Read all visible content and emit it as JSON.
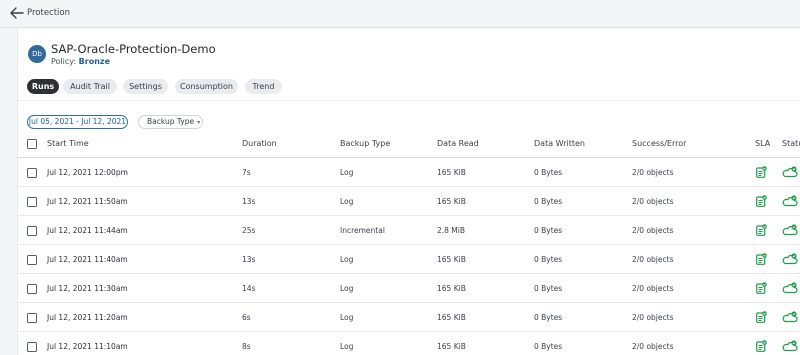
{
  "breadcrumb": {
    "label": "Protection"
  },
  "header": {
    "avatar_initials": "Db",
    "title": "SAP-Oracle-Protection-Demo",
    "policy_label": "Policy:",
    "policy_value": "Bronze"
  },
  "tabs": [
    {
      "label": "Runs",
      "active": true
    },
    {
      "label": "Audit Trail",
      "active": false
    },
    {
      "label": "Settings",
      "active": false
    },
    {
      "label": "Consumption",
      "active": false
    },
    {
      "label": "Trend",
      "active": false
    }
  ],
  "filters": {
    "date_range": "Jul 05, 2021 - Jul 12, 2021",
    "backup_type": "Backup Type"
  },
  "table": {
    "columns": [
      "Start Time",
      "Duration",
      "Backup Type",
      "Data Read",
      "Data Written",
      "Success/Error",
      "SLA",
      "Status"
    ],
    "rows": [
      {
        "start": "Jul 12, 2021 12:00pm",
        "duration": "7s",
        "type": "Log",
        "read": "165 KiB",
        "written": "0 Bytes",
        "result": "2/0 objects"
      },
      {
        "start": "Jul 12, 2021 11:50am",
        "duration": "13s",
        "type": "Log",
        "read": "165 KiB",
        "written": "0 Bytes",
        "result": "2/0 objects"
      },
      {
        "start": "Jul 12, 2021 11:44am",
        "duration": "25s",
        "type": "Incremental",
        "read": "2.8 MiB",
        "written": "0 Bytes",
        "result": "2/0 objects"
      },
      {
        "start": "Jul 12, 2021 11:40am",
        "duration": "13s",
        "type": "Log",
        "read": "165 KiB",
        "written": "0 Bytes",
        "result": "2/0 objects"
      },
      {
        "start": "Jul 12, 2021 11:30am",
        "duration": "14s",
        "type": "Log",
        "read": "165 KiB",
        "written": "0 Bytes",
        "result": "2/0 objects"
      },
      {
        "start": "Jul 12, 2021 11:20am",
        "duration": "6s",
        "type": "Log",
        "read": "165 KiB",
        "written": "0 Bytes",
        "result": "2/0 objects"
      },
      {
        "start": "Jul 12, 2021 11:10am",
        "duration": "8s",
        "type": "Log",
        "read": "165 KiB",
        "written": "0 Bytes",
        "result": "2/0 objects"
      }
    ],
    "sla_icon": "sla-met-icon",
    "status_icon": "cloud-success-icon"
  },
  "colors": {
    "accent": "#1f5c99",
    "success": "#1e9e4a",
    "active_tab": "#2d3136"
  }
}
